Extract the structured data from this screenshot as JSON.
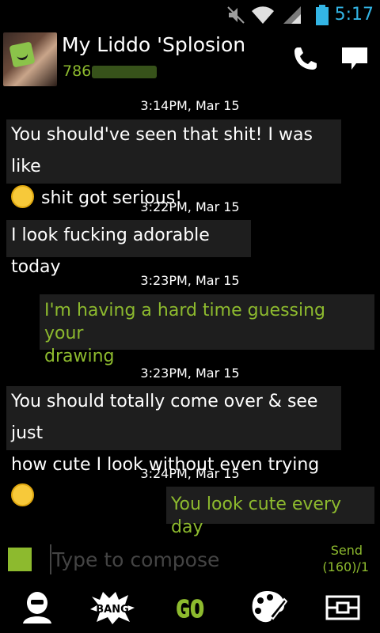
{
  "status_bar": {
    "time": "5:17",
    "icons": [
      "mute-icon",
      "wifi-icon",
      "signal-icon",
      "battery-icon"
    ],
    "accent_color": "#33b5e5"
  },
  "header": {
    "contact_name": "My Liddo 'Splosion",
    "contact_number_visible": "786",
    "icons": [
      "call-icon",
      "message-icon"
    ]
  },
  "conversation": {
    "messages": [
      {
        "timestamp": "3:14PM, Mar 15",
        "direction": "incoming",
        "line1": "You should've seen that shit! I was like",
        "line2": "shit got serious!",
        "emoji": "flushed-face-emoji"
      },
      {
        "timestamp": "3:22PM, Mar 15",
        "direction": "incoming",
        "line1": "I look fucking adorable today"
      },
      {
        "timestamp": "3:23PM, Mar 15",
        "direction": "outgoing",
        "line1": "I'm having a hard time guessing your",
        "line2": "drawing"
      },
      {
        "timestamp": "3:23PM, Mar 15",
        "direction": "incoming",
        "line1": "You should totally come over & see just",
        "line2": "how cute I look without even trying",
        "emoji": "smiling-blush-emoji"
      },
      {
        "timestamp": "3:24PM, Mar 15",
        "direction": "outgoing",
        "line1": "You look cute every day"
      }
    ],
    "outgoing_color": "#8dba2e",
    "bubble_color": "#1e1e1e"
  },
  "compose": {
    "placeholder": "Type to compose",
    "send_label": "Send",
    "char_count": "(160)/1"
  },
  "toolbar": {
    "items": [
      "contact-icon",
      "bang-icon",
      "go-icon",
      "palette-icon",
      "ticket-icon"
    ],
    "bang_label": "BANG",
    "go_label": "GO"
  }
}
